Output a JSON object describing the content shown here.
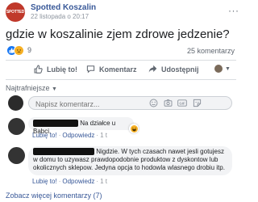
{
  "post": {
    "page_name": "Spotted Koszalin",
    "avatar_text": "SPOTTED",
    "date": "22 listopada o 20:17",
    "text": "gdzie w koszalinie zjem zdrowe jedzenie?",
    "reaction_count": "9",
    "comments_count": "25 komentarzy"
  },
  "actions": {
    "like": "Lubię to!",
    "comment": "Komentarz",
    "share": "Udostępnij"
  },
  "sort_label": "Najtrafniejsze",
  "comment_input": {
    "placeholder": "Napisz komentarz..."
  },
  "comments": [
    {
      "text": "Na działce u Babci.",
      "like": "Lubię to!",
      "reply": "Odpowiedz",
      "time": "1 t"
    },
    {
      "line1": "Nigdzie. W tych czasach nawet jesli gotujesz",
      "line2": "w domu to uzywasz prawdopodobnie produktow z dyskontow lub",
      "line3": "okolicznych sklepow. Jedyna opcja to hodowla wlasnego drobiu itp.",
      "like": "Lubię to!",
      "reply": "Odpowiedz",
      "time": "1 t"
    }
  ],
  "more_comments": "Zobacz więcej komentarzy (7)",
  "colors": {
    "link": "#385898",
    "like_blue": "#1877f2",
    "page_avatar": "#c0392b"
  }
}
